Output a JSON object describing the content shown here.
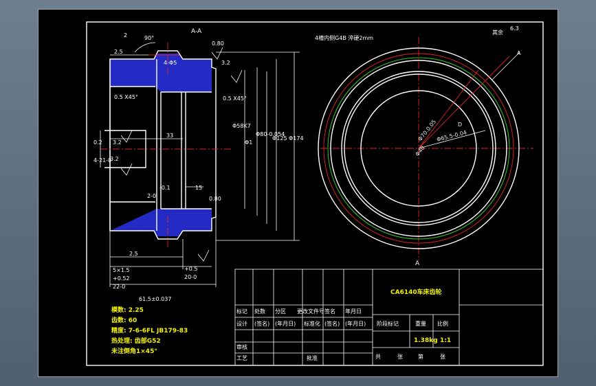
{
  "drawing": {
    "section_label": "A-A",
    "view_label_right": "A",
    "view_label_arrow": "A",
    "note_keyway": "4槽内侧G4B 淬硬2mm",
    "roughness_other": "其余",
    "roughness_other_value": "6.3"
  },
  "dimensions": {
    "d_90deg": "90°",
    "d_2": "2",
    "d_2_5_top": "2.5",
    "d_4_phi5": "4-Φ5",
    "d_0_80_top": "0.80",
    "d_3_2_top": "3.2",
    "d_0_5x45_left": "0.5 X45°",
    "d_0_5x45_right": "0.5 X45°",
    "d_0_2": "0.2",
    "d_4_21": "4-21-0",
    "d_3_2_mid": "3.2",
    "d_3_2_left": "3.2",
    "d_33": "33",
    "d_phi58": "Φ58K7",
    "d_phi1": "Φ1",
    "d_phi80": "Φ80-0.054",
    "d_phi125": "Φ125",
    "d_phi174": "Φ174",
    "d_0_1": "-0.1",
    "d_2_0": "2-0",
    "d_15": "15",
    "d_0_80_bot": "0.80",
    "d_2_5_bot": "2.5",
    "d_5x1_5": "5×1.5",
    "d_0_52": "+0.52",
    "d_22_0": "22-0",
    "d_plus_0_5": "+0.5",
    "d_20_0": "20-0",
    "d_61_5": "61.5±0.037",
    "d_phi_circ1": "Φ70.0.05",
    "d_phi_circ2": "Φ65.5-0.04",
    "d_phi_circ3": "Φ40",
    "d_D": "D"
  },
  "spec_notes": [
    "模数: 2.25",
    "齿数: 60",
    "精度: 7-6-6FL JB179-83",
    "热处理: 齿部G52",
    "未注倒角1×45°"
  ],
  "title_block": {
    "part_name": "CA6140车床齿轮",
    "headers_row1": [
      "标记",
      "处数",
      "分区",
      "更改文件号",
      "签名",
      "年月日"
    ],
    "headers_row2": [
      "设计",
      "(签名)",
      "(年月日)",
      "标准化",
      "(签名)",
      "(年月日)"
    ],
    "stage_label": "阶段标记",
    "weight_label": "重量",
    "scale_label": "比例",
    "weight_value": "1.38kg",
    "scale_value": "1:1",
    "review_label": "审核",
    "process_label": "工艺",
    "approve_label": "批准",
    "total_label": "共",
    "sheets_label": "张",
    "sheet_no_label": "第",
    "sheet_label": "张"
  },
  "colors": {
    "background": "#000000",
    "outline": "#ffffff",
    "centerline": "#e12424",
    "hatch": "#2a33e6",
    "circle_green": "#31c531",
    "note_yellow": "#f2f200",
    "window_frame": "#5f7182"
  }
}
